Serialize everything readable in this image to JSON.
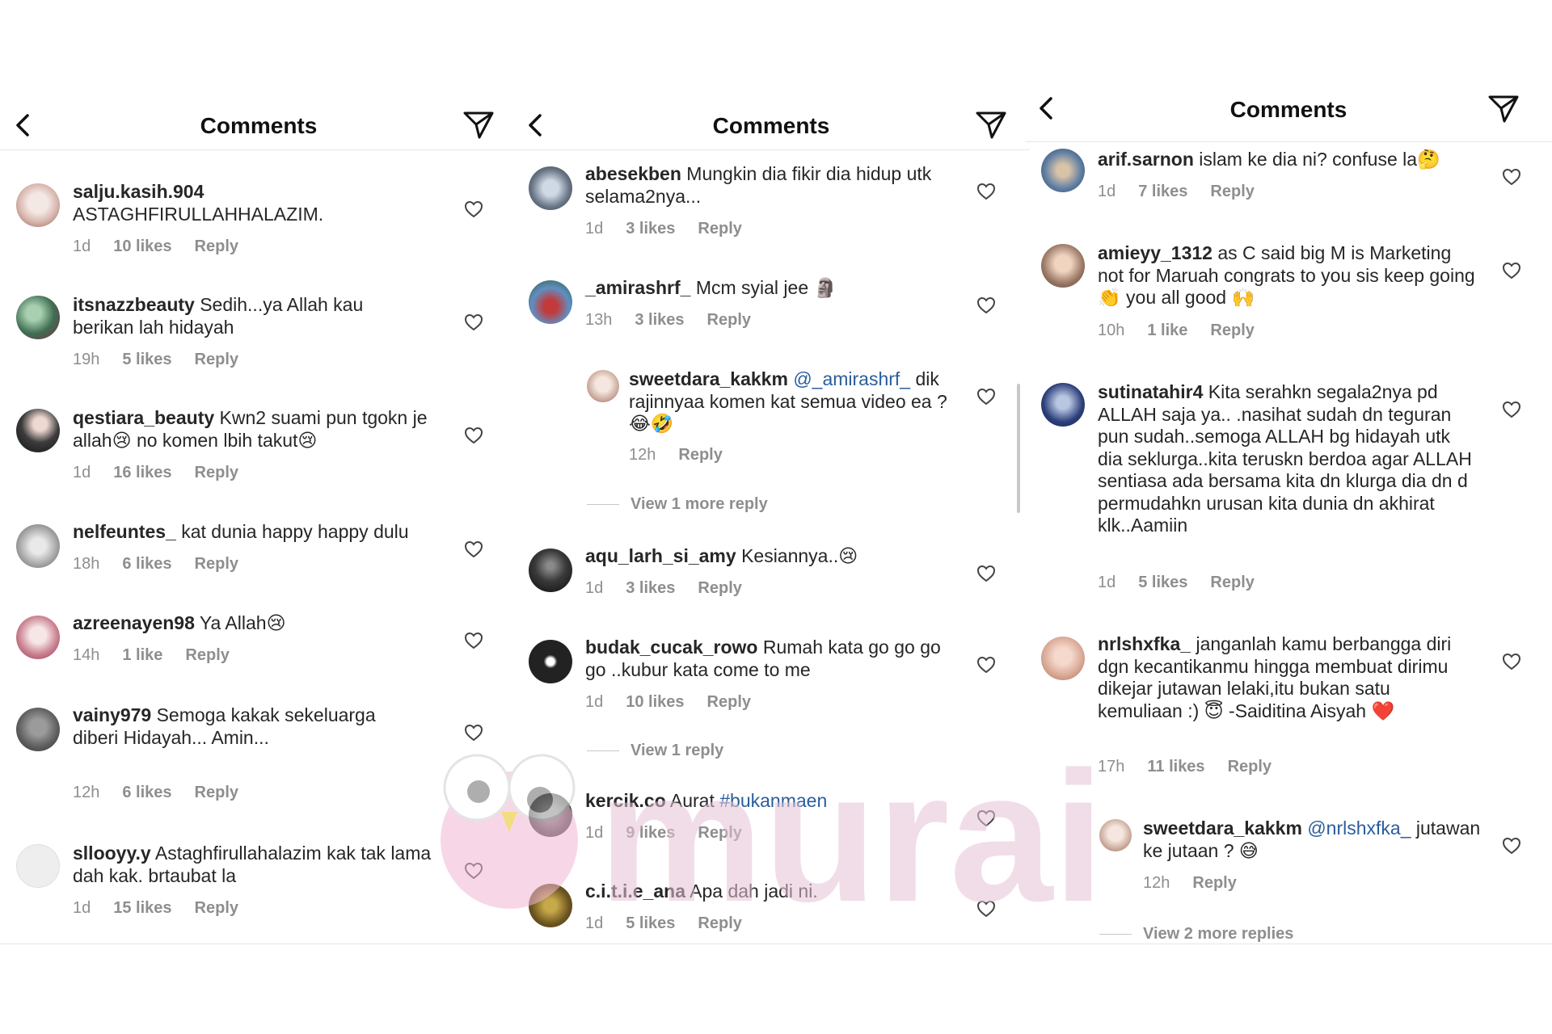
{
  "panels": [
    {
      "title": "Comments",
      "comments": [
        {
          "user": "salju.kasih.904",
          "text": "ASTAGHFIRULLAHHALAZIM.",
          "time": "1d",
          "likes": "10 likes",
          "reply": "Reply"
        },
        {
          "user": "itsnazzbeauty",
          "text": "Sedih...ya Allah kau berikan lah hidayah",
          "time": "19h",
          "likes": "5 likes",
          "reply": "Reply"
        },
        {
          "user": "qestiara_beauty",
          "text": "Kwn2 suami pun tgokn je allah😢 no komen lbih takut😢",
          "time": "1d",
          "likes": "16 likes",
          "reply": "Reply"
        },
        {
          "user": "nelfeuntes_",
          "text": "kat dunia happy happy dulu",
          "time": "18h",
          "likes": "6 likes",
          "reply": "Reply"
        },
        {
          "user": "azreenayen98",
          "text": "Ya Allah😢",
          "time": "14h",
          "likes": "1 like",
          "reply": "Reply"
        },
        {
          "user": "vainy979",
          "text": "Semoga kakak sekeluarga diberi Hidayah... Amin...",
          "time": "12h",
          "likes": "6 likes",
          "reply": "Reply"
        },
        {
          "user": "sllooyy.y",
          "text": "Astaghfirullahalazim kak tak lama dah kak. brtaubat la",
          "time": "1d",
          "likes": "15 likes",
          "reply": "Reply"
        }
      ]
    },
    {
      "title": "Comments",
      "comments": [
        {
          "user": "abesekben",
          "text": "Mungkin dia fikir dia hidup utk selama2nya...",
          "time": "1d",
          "likes": "3 likes",
          "reply": "Reply"
        },
        {
          "user": "_amirashrf_",
          "text": "Mcm syial jee 🗿",
          "time": "13h",
          "likes": "3 likes",
          "reply": "Reply"
        },
        {
          "user": "sweetdara_kakkm",
          "mention": "@_amirashrf_",
          "text": "dik rajinnyaa komen kat semua video ea ? 😂🤣",
          "time": "12h",
          "likes": "",
          "reply": "Reply",
          "view_more": "View 1 more reply"
        },
        {
          "user": "aqu_larh_si_amy",
          "text": "Kesiannya..😢",
          "time": "1d",
          "likes": "3 likes",
          "reply": "Reply"
        },
        {
          "user": "budak_cucak_rowo",
          "text": "Rumah kata go go go go ..kubur kata come to me",
          "time": "1d",
          "likes": "10 likes",
          "reply": "Reply",
          "view_more": "View 1 reply"
        },
        {
          "user": "kercik.co",
          "text": "Aurat",
          "hashtag": "#bukanmaen",
          "time": "1d",
          "likes": "9 likes",
          "reply": "Reply"
        },
        {
          "user": "c.i.t.i.e_ana",
          "text": "Apa dah jadi ni.",
          "time": "1d",
          "likes": "5 likes",
          "reply": "Reply"
        }
      ]
    },
    {
      "title": "Comments",
      "comments": [
        {
          "user": "arif.sarnon",
          "text": "islam ke dia ni? confuse la🤔",
          "time": "1d",
          "likes": "7 likes",
          "reply": "Reply"
        },
        {
          "user": "amieyy_1312",
          "text": "as C said big M is Marketing  not for Maruah congrats to you sis keep going👏  you all good 🙌",
          "time": "10h",
          "likes": "1 like",
          "reply": "Reply"
        },
        {
          "user": "sutinatahir4",
          "text": "Kita serahkn segala2nya pd ALLAH saja ya.. .nasihat sudah dn teguran pun sudah..semoga ALLAH bg hidayah utk dia seklurga..kita teruskn berdoa agar ALLAH sentiasa ada bersama kita dn klurga dia dn d permudahkn urusan kita dunia dn akhirat klk..Aamiin",
          "time": "1d",
          "likes": "5 likes",
          "reply": "Reply"
        },
        {
          "user": "nrlshxfka_",
          "text": "janganlah kamu berbangga diri dgn kecantikanmu hingga membuat dirimu dikejar jutawan lelaki,itu bukan satu kemuliaan :) 😇 -Saiditina Aisyah ❤️",
          "time": "17h",
          "likes": "11 likes",
          "reply": "Reply"
        },
        {
          "user": "sweetdara_kakkm",
          "mention": "@nrlshxfka_",
          "text": "jutawan ke jutaan ? 😅",
          "time": "12h",
          "likes": "",
          "reply": "Reply",
          "view_more": "View 2 more replies"
        }
      ]
    }
  ],
  "watermark": "murai",
  "colors": {
    "text": "#262626",
    "meta": "#8e8e8e",
    "mention": "#2a5d9c",
    "divider": "#e6e6e6"
  },
  "icons": [
    "back-arrow-icon",
    "send-icon",
    "heart-icon"
  ]
}
